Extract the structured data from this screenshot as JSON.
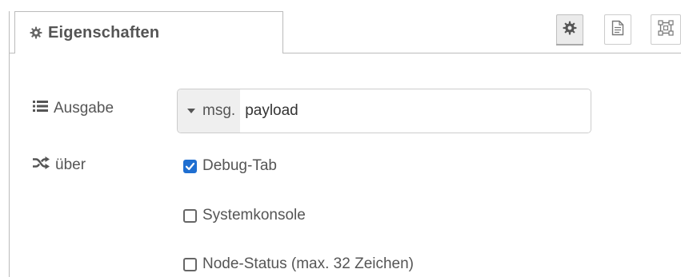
{
  "tabs": {
    "properties_label": "Eigenschaften"
  },
  "toolbar": {
    "icons": [
      "gear-icon",
      "document-icon",
      "frame-icon"
    ]
  },
  "form": {
    "output_label": "Ausgabe",
    "output_type_prefix": "msg.",
    "output_value": "payload",
    "via_label": "über",
    "targets": [
      {
        "label": "Debug-Tab",
        "checked": true
      },
      {
        "label": "Systemkonsole",
        "checked": false
      },
      {
        "label": "Node-Status (max. 32 Zeichen)",
        "checked": false
      }
    ]
  },
  "colors": {
    "checkbox_checked": "#1f6fd1",
    "border": "#bbbbbb",
    "text": "#555555"
  }
}
